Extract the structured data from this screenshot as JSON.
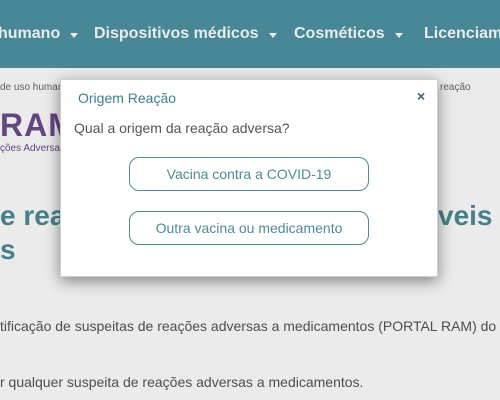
{
  "nav": {
    "items": [
      {
        "label": "humano"
      },
      {
        "label": "Dispositivos médicos"
      },
      {
        "label": "Cosméticos"
      },
      {
        "label": "Licenciam"
      }
    ]
  },
  "breadcrumb": {
    "left": "de uso humano",
    "right": "reação"
  },
  "brand": {
    "name": "RAM",
    "subtitle": "ções Adversas"
  },
  "hero": {
    "line1_left": "e reac",
    "line1_right": "veis d",
    "line2": "s"
  },
  "body": {
    "line1": "tificação de suspeitas de reações adversas a medicamentos (PORTAL RAM) do S",
    "line2": "r qualquer suspeita de reações adversas a medicamentos."
  },
  "modal": {
    "title": "Origem Reação",
    "close": "×",
    "question": "Qual a origem da reação adversa?",
    "options": [
      {
        "label": "Vacina contra a COVID-19"
      },
      {
        "label": "Outra vacina ou medicamento"
      }
    ]
  },
  "colors": {
    "nav_bg": "#4e93a3",
    "accent": "#4e8a97",
    "brand": "#6b4e8d"
  }
}
